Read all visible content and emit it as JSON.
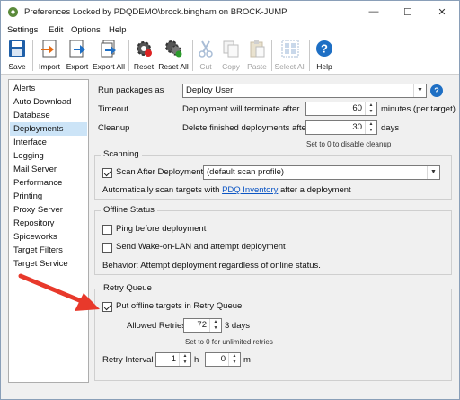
{
  "window": {
    "title": "Preferences Locked by PDQDEMO\\brock.bingham on BROCK-JUMP",
    "controls": {
      "minimize": "—",
      "maximize": "☐",
      "close": "✕"
    }
  },
  "menu": [
    "Settings",
    "Edit",
    "Options",
    "Help"
  ],
  "toolbar": {
    "save": "Save",
    "import": "Import",
    "export": "Export",
    "export_all": "Export All",
    "reset": "Reset",
    "reset_all": "Reset All",
    "cut": "Cut",
    "copy": "Copy",
    "paste": "Paste",
    "select_all": "Select All",
    "help": "Help",
    "disabled": [
      "Cut",
      "Copy",
      "Paste",
      "Select All"
    ]
  },
  "sidebar": {
    "items": [
      "Alerts",
      "Auto Download",
      "Database",
      "Deployments",
      "Interface",
      "Logging",
      "Mail Server",
      "Performance",
      "Printing",
      "Proxy Server",
      "Repository",
      "Spiceworks",
      "Target Filters",
      "Target Service"
    ],
    "selected": "Deployments"
  },
  "deployments": {
    "run_as_label": "Run packages as",
    "run_as_value": "Deploy User",
    "timeout_label": "Timeout",
    "timeout_desc": "Deployment will terminate after",
    "timeout_value": "60",
    "timeout_unit": "minutes (per target)",
    "cleanup_label": "Cleanup",
    "cleanup_desc": "Delete finished deployments after",
    "cleanup_value": "30",
    "cleanup_unit": "days",
    "cleanup_hint": "Set to 0 to disable cleanup"
  },
  "scanning": {
    "title": "Scanning",
    "scan_after_label": "Scan After Deployment",
    "scan_after_checked": true,
    "scan_profile": "(default scan profile)",
    "info_pre": "Automatically scan targets with",
    "info_link": "PDQ Inventory",
    "info_post": "after a deployment"
  },
  "offline": {
    "title": "Offline Status",
    "ping_label": "Ping before deployment",
    "ping_checked": false,
    "wol_label": "Send Wake-on-LAN and attempt deployment",
    "wol_checked": false,
    "behavior": "Behavior: Attempt deployment regardless of online status."
  },
  "retry": {
    "title": "Retry Queue",
    "put_offline_label": "Put offline targets in Retry Queue",
    "put_offline_checked": true,
    "allowed_label": "Allowed Retries",
    "allowed_value": "72",
    "allowed_suffix": "3 days",
    "allowed_hint": "Set to 0 for unlimited retries",
    "interval_label": "Retry Interval",
    "interval_hours": "1",
    "interval_hours_unit": "h",
    "interval_minutes": "0",
    "interval_minutes_unit": "m"
  },
  "colors": {
    "accent": "#1e6fc4",
    "selection": "#cce4f7",
    "arrow": "#e8392b",
    "link": "#0b55c4"
  }
}
